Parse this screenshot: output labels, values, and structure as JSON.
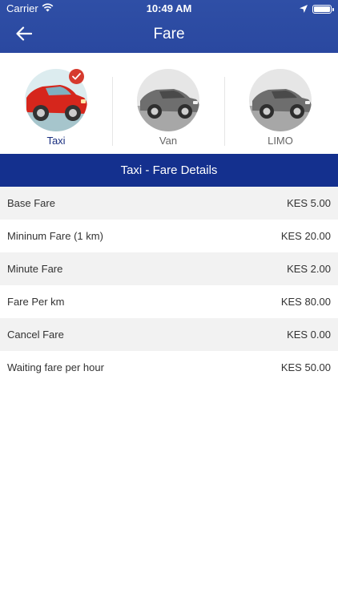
{
  "status_bar": {
    "carrier": "Carrier",
    "time": "10:49 AM"
  },
  "nav": {
    "title": "Fare"
  },
  "vehicles": [
    {
      "label": "Taxi",
      "selected": true,
      "car_color": "#d6261c"
    },
    {
      "label": "Van",
      "selected": false,
      "car_color": "#6e6e6e"
    },
    {
      "label": "LIMO",
      "selected": false,
      "car_color": "#6e6e6e"
    }
  ],
  "section": {
    "title": "Taxi - Fare Details"
  },
  "fares": [
    {
      "label": "Base Fare",
      "value": "KES 5.00"
    },
    {
      "label": "Mininum Fare (1 km)",
      "value": "KES 20.00"
    },
    {
      "label": "Minute Fare",
      "value": "KES 2.00"
    },
    {
      "label": "Fare Per km",
      "value": "KES 80.00"
    },
    {
      "label": "Cancel Fare",
      "value": "KES 0.00"
    },
    {
      "label": "Waiting fare per hour",
      "value": "KES 50.00"
    }
  ],
  "icons": {
    "back": "back-arrow-icon",
    "wifi": "wifi-icon",
    "location": "location-arrow-icon",
    "battery": "battery-icon",
    "check": "check-icon"
  },
  "colors": {
    "header": "#2f4fa6",
    "section_bar": "#14308e",
    "selected_badge": "#d63a2e",
    "selected_label": "#1a2f80"
  }
}
